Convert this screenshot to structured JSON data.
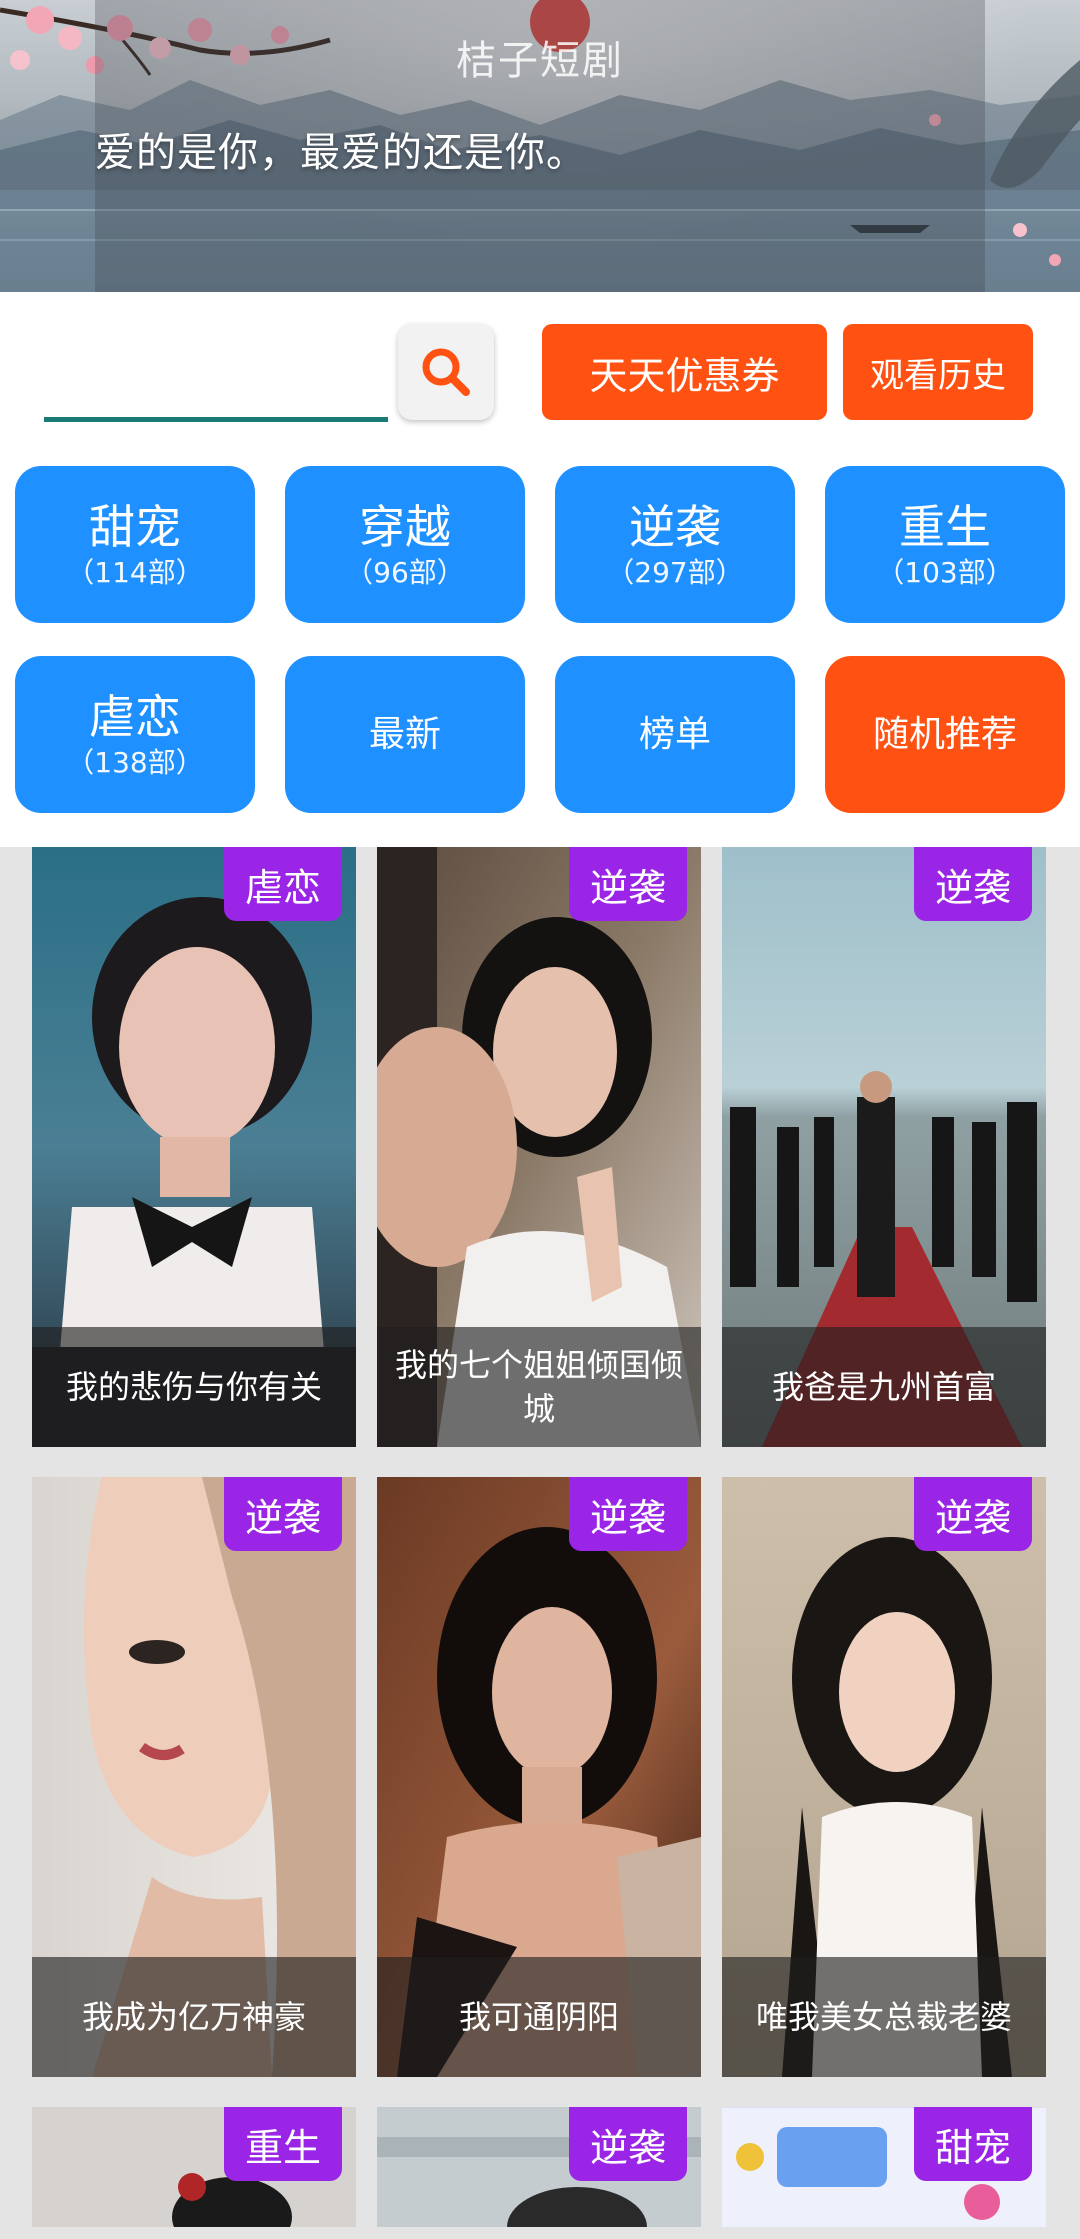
{
  "banner": {
    "app_title": "桔子短剧",
    "slogan": "爱的是你，最爱的还是你。"
  },
  "toolbar": {
    "search_value": "",
    "search_placeholder": "",
    "coupon_label": "天天优惠券",
    "history_label": "观看历史",
    "accent_orange": "#ff5111",
    "accent_blue": "#1e90ff"
  },
  "categories": [
    {
      "name": "甜宠",
      "count": "（114部）"
    },
    {
      "name": "穿越",
      "count": "（96部）"
    },
    {
      "name": "逆袭",
      "count": "（297部）"
    },
    {
      "name": "重生",
      "count": "（103部）"
    },
    {
      "name": "虐恋",
      "count": "（138部）"
    },
    {
      "name": "最新"
    },
    {
      "name": "榜单"
    },
    {
      "name": "随机推荐"
    }
  ],
  "dramas": [
    {
      "tag": "虐恋",
      "title": "我的悲伤与你有关"
    },
    {
      "tag": "逆袭",
      "title": "我的七个姐姐倾国倾城"
    },
    {
      "tag": "逆袭",
      "title": "我爸是九州首富"
    },
    {
      "tag": "逆袭",
      "title": "我成为亿万神豪"
    },
    {
      "tag": "逆袭",
      "title": "我可通阴阳"
    },
    {
      "tag": "逆袭",
      "title": "唯我美女总裁老婆"
    },
    {
      "tag": "重生",
      "title": ""
    },
    {
      "tag": "逆袭",
      "title": ""
    },
    {
      "tag": "甜宠",
      "title": ""
    }
  ],
  "tag_color": "#9a25e6"
}
